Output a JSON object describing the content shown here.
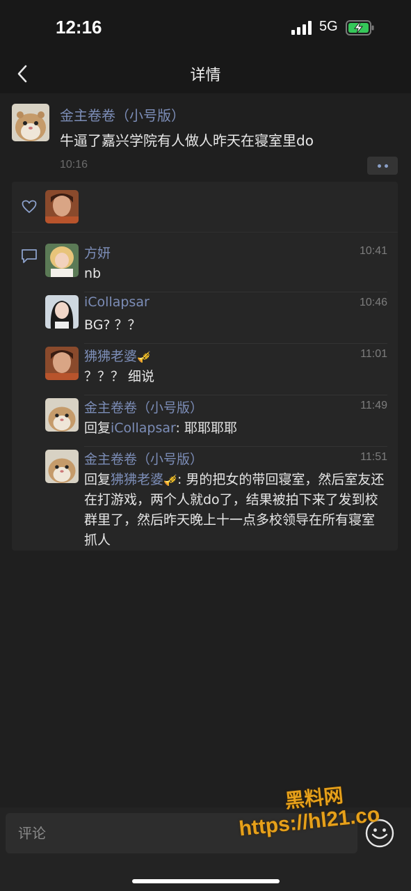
{
  "status_bar": {
    "time": "12:16",
    "network": "5G"
  },
  "nav": {
    "title": "详情"
  },
  "post": {
    "author": "金主卷卷（小号版）",
    "text": "牛逼了嘉兴学院有人做人昨天在寝室里do",
    "time": "10:16"
  },
  "comments": [
    {
      "name": "方妍",
      "time": "10:41",
      "text": "nb"
    },
    {
      "name": "iCollapsar",
      "time": "10:46",
      "text": "BG? ？？"
    },
    {
      "name": "狒狒老婆",
      "name_emoji": "🎺",
      "time": "11:01",
      "text": "？？？ 细说"
    },
    {
      "name": "金主卷卷（小号版）",
      "time": "11:49",
      "reply_prefix": "回复",
      "reply_to": "iCollapsar",
      "text": ": 耶耶耶耶"
    },
    {
      "name": "金主卷卷（小号版）",
      "time": "11:51",
      "reply_prefix": "回复",
      "reply_to": "狒狒老婆",
      "reply_emoji": "🎺",
      "text": ": 男的把女的带回寝室，然后室友还在打游戏，两个人就do了，结果被拍下来了发到校群里了，然后昨天晚上十一点多校领导在所有寝室抓人"
    }
  ],
  "input": {
    "placeholder": "评论"
  },
  "watermark": {
    "top": "黑料网",
    "url": "https://hl21.co"
  },
  "colors": {
    "name_link": "#7c8db7",
    "background": "#1f1f1f",
    "watermark": "#e6a01a"
  }
}
